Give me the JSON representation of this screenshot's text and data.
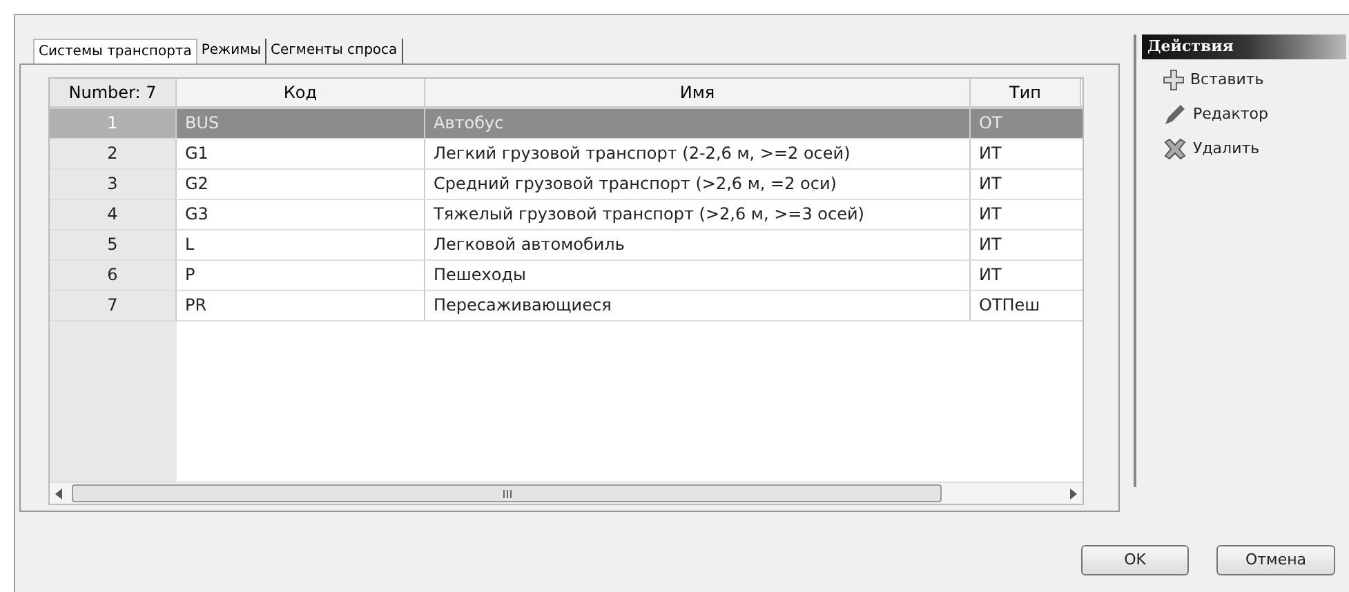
{
  "tabs": [
    {
      "label": "Системы транспорта",
      "selected": true
    },
    {
      "label": "Режимы",
      "selected": false
    },
    {
      "label": "Сегменты спроса",
      "selected": false
    }
  ],
  "table": {
    "columns": [
      "Number: 7",
      "Код",
      "Имя",
      "Тип"
    ],
    "rows": [
      {
        "number": "1",
        "code": "BUS",
        "name": "Автобус",
        "type": "ОТ",
        "selected": true
      },
      {
        "number": "2",
        "code": "G1",
        "name": "Легкий грузовой транспорт (2-2,6 м, >=2 осей)",
        "type": "ИТ",
        "selected": false
      },
      {
        "number": "3",
        "code": "G2",
        "name": "Средний грузовой транспорт (>2,6 м, =2 оси)",
        "type": "ИТ",
        "selected": false
      },
      {
        "number": "4",
        "code": "G3",
        "name": "Тяжелый грузовой транспорт (>2,6 м, >=3 осей)",
        "type": "ИТ",
        "selected": false
      },
      {
        "number": "5",
        "code": "L",
        "name": "Легковой автомобиль",
        "type": "ИТ",
        "selected": false
      },
      {
        "number": "6",
        "code": "P",
        "name": "Пешеходы",
        "type": "ИТ",
        "selected": false
      },
      {
        "number": "7",
        "code": "PR",
        "name": "Пересаживающиеся",
        "type": "ОТПеш",
        "selected": false
      }
    ]
  },
  "actions": {
    "title": "Действия",
    "items": [
      {
        "kind": "insert",
        "label": "Вставить"
      },
      {
        "kind": "edit",
        "label": "Редактор"
      },
      {
        "kind": "delete",
        "label": "Удалить"
      }
    ]
  },
  "buttons": [
    "OK",
    "Отмена"
  ]
}
